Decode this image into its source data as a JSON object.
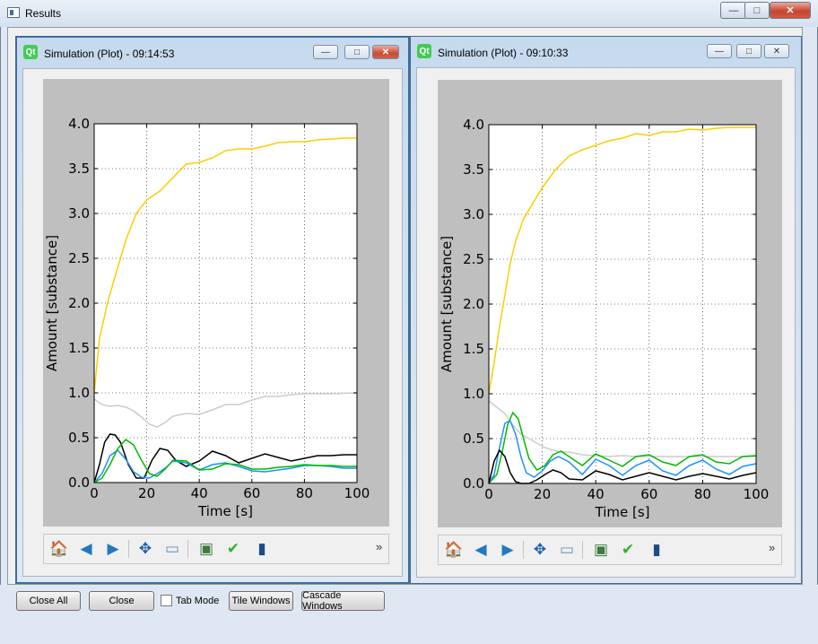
{
  "main_window": {
    "title": "Results",
    "min_glyph": "—",
    "max_glyph": "□",
    "close_glyph": "✕"
  },
  "windows": [
    {
      "title": "Simulation (Plot) - 09:14:53",
      "min_glyph": "—",
      "max_glyph": "□",
      "close_glyph": "✕"
    },
    {
      "title": "Simulation (Plot) - 09:10:33",
      "min_glyph": "—",
      "max_glyph": "□",
      "close_glyph": "✕"
    }
  ],
  "toolbar": {
    "icons": [
      "home-icon",
      "back-arrow-icon",
      "forward-arrow-icon",
      "pan-icon",
      "zoom-icon",
      "configure-subplots-icon",
      "check-icon",
      "save-icon"
    ],
    "more_label": "»"
  },
  "bottom": {
    "close_all": "Close All",
    "close": "Close",
    "tab_mode": "Tab Mode",
    "tab_mode_checked": false,
    "tile": "Tile Windows",
    "cascade": "Cascade Windows"
  },
  "chart_data": [
    {
      "type": "line",
      "xlabel": "Time [s]",
      "ylabel": "Amount [substance]",
      "xlim": [
        0,
        100
      ],
      "ylim": [
        0,
        4.0
      ],
      "xticks": [
        "0",
        "20",
        "40",
        "60",
        "80",
        "100"
      ],
      "yticks": [
        "0.0",
        "0.5",
        "1.0",
        "1.5",
        "2.0",
        "2.5",
        "3.0",
        "3.5",
        "4.0"
      ],
      "grid": true,
      "series": [
        {
          "color": "#ffcc00",
          "x": [
            0,
            2,
            5,
            8,
            12,
            16,
            20,
            25,
            30,
            35,
            40,
            45,
            50,
            55,
            60,
            65,
            70,
            75,
            80,
            85,
            90,
            95,
            100
          ],
          "y": [
            1.0,
            1.6,
            2.0,
            2.3,
            2.7,
            3.0,
            3.15,
            3.25,
            3.4,
            3.55,
            3.57,
            3.62,
            3.7,
            3.72,
            3.72,
            3.75,
            3.79,
            3.8,
            3.8,
            3.82,
            3.83,
            3.84,
            3.84
          ]
        },
        {
          "color": "#cccccc",
          "x": [
            0,
            3,
            6,
            9,
            12,
            15,
            18,
            21,
            24,
            27,
            30,
            35,
            40,
            45,
            50,
            55,
            60,
            65,
            70,
            75,
            80,
            90,
            100
          ],
          "y": [
            0.93,
            0.87,
            0.85,
            0.86,
            0.84,
            0.8,
            0.73,
            0.65,
            0.62,
            0.67,
            0.74,
            0.77,
            0.76,
            0.81,
            0.87,
            0.87,
            0.92,
            0.96,
            0.96,
            0.98,
            0.99,
            0.99,
            1.0
          ]
        },
        {
          "color": "#000000",
          "x": [
            0,
            2,
            4,
            6,
            8,
            10,
            13,
            16,
            19,
            22,
            25,
            28,
            31,
            35,
            40,
            45,
            50,
            55,
            60,
            65,
            70,
            75,
            80,
            85,
            90,
            95,
            100
          ],
          "y": [
            0,
            0.2,
            0.45,
            0.54,
            0.53,
            0.45,
            0.2,
            0.05,
            0.05,
            0.25,
            0.38,
            0.36,
            0.25,
            0.18,
            0.24,
            0.35,
            0.3,
            0.22,
            0.27,
            0.32,
            0.28,
            0.24,
            0.27,
            0.3,
            0.3,
            0.31,
            0.31
          ]
        },
        {
          "color": "#1e90ff",
          "x": [
            0,
            3,
            6,
            9,
            12,
            15,
            18,
            21,
            24,
            27,
            30,
            35,
            40,
            45,
            50,
            55,
            60,
            65,
            70,
            75,
            80,
            85,
            90,
            95,
            100
          ],
          "y": [
            0,
            0.1,
            0.3,
            0.36,
            0.26,
            0.12,
            0.06,
            0.05,
            0.1,
            0.16,
            0.24,
            0.22,
            0.14,
            0.2,
            0.22,
            0.18,
            0.13,
            0.12,
            0.14,
            0.16,
            0.19,
            0.19,
            0.18,
            0.16,
            0.16
          ]
        },
        {
          "color": "#00bb00",
          "x": [
            0,
            3,
            6,
            9,
            12,
            15,
            18,
            21,
            24,
            27,
            30,
            35,
            40,
            45,
            50,
            55,
            60,
            65,
            70,
            75,
            80,
            85,
            90,
            95,
            100
          ],
          "y": [
            0,
            0.05,
            0.2,
            0.38,
            0.48,
            0.42,
            0.25,
            0.1,
            0.07,
            0.15,
            0.25,
            0.24,
            0.14,
            0.15,
            0.21,
            0.2,
            0.15,
            0.15,
            0.17,
            0.18,
            0.2,
            0.19,
            0.19,
            0.18,
            0.18
          ]
        }
      ]
    },
    {
      "type": "line",
      "xlabel": "Time [s]",
      "ylabel": "Amount [substance]",
      "xlim": [
        0,
        100
      ],
      "ylim": [
        0,
        4.0
      ],
      "xticks": [
        "0",
        "20",
        "40",
        "60",
        "80",
        "100"
      ],
      "yticks": [
        "0.0",
        "0.5",
        "1.0",
        "1.5",
        "2.0",
        "2.5",
        "3.0",
        "3.5",
        "4.0"
      ],
      "grid": true,
      "series": [
        {
          "color": "#ffcc00",
          "x": [
            0,
            2,
            4,
            6,
            8,
            10,
            13,
            16,
            20,
            25,
            30,
            35,
            40,
            45,
            50,
            55,
            60,
            65,
            70,
            75,
            80,
            85,
            90,
            95,
            100
          ],
          "y": [
            1.0,
            1.35,
            1.75,
            2.1,
            2.45,
            2.7,
            2.95,
            3.1,
            3.3,
            3.5,
            3.65,
            3.72,
            3.77,
            3.82,
            3.85,
            3.9,
            3.88,
            3.92,
            3.92,
            3.95,
            3.94,
            3.96,
            3.97,
            3.97,
            3.97
          ]
        },
        {
          "color": "#cccccc",
          "x": [
            0,
            3,
            6,
            9,
            12,
            15,
            18,
            21,
            24,
            27,
            30,
            35,
            40,
            45,
            50,
            55,
            60,
            70,
            80,
            90,
            100
          ],
          "y": [
            0.92,
            0.85,
            0.78,
            0.65,
            0.55,
            0.5,
            0.45,
            0.4,
            0.37,
            0.35,
            0.35,
            0.32,
            0.31,
            0.3,
            0.31,
            0.3,
            0.3,
            0.3,
            0.3,
            0.3,
            0.3
          ]
        },
        {
          "color": "#00bb00",
          "x": [
            0,
            3,
            5,
            7,
            9,
            11,
            13,
            15,
            18,
            21,
            24,
            27,
            30,
            35,
            40,
            45,
            50,
            55,
            60,
            65,
            70,
            75,
            80,
            85,
            90,
            95,
            100
          ],
          "y": [
            0,
            0.1,
            0.35,
            0.65,
            0.79,
            0.72,
            0.5,
            0.28,
            0.15,
            0.2,
            0.32,
            0.36,
            0.3,
            0.2,
            0.33,
            0.26,
            0.19,
            0.3,
            0.32,
            0.24,
            0.2,
            0.3,
            0.32,
            0.24,
            0.22,
            0.3,
            0.31
          ]
        },
        {
          "color": "#1e90ff",
          "x": [
            0,
            2,
            4,
            6,
            8,
            10,
            12,
            14,
            17,
            20,
            23,
            26,
            30,
            35,
            40,
            45,
            50,
            55,
            60,
            65,
            70,
            75,
            80,
            85,
            90,
            95,
            100
          ],
          "y": [
            0,
            0.1,
            0.4,
            0.67,
            0.7,
            0.55,
            0.3,
            0.12,
            0.07,
            0.14,
            0.25,
            0.3,
            0.24,
            0.1,
            0.27,
            0.2,
            0.09,
            0.2,
            0.26,
            0.14,
            0.09,
            0.2,
            0.26,
            0.16,
            0.1,
            0.19,
            0.22
          ]
        },
        {
          "color": "#000000",
          "x": [
            0,
            2,
            4,
            6,
            8,
            10,
            12,
            15,
            18,
            21,
            24,
            27,
            30,
            35,
            40,
            45,
            50,
            55,
            60,
            65,
            70,
            75,
            80,
            85,
            90,
            95,
            100
          ],
          "y": [
            0,
            0.25,
            0.37,
            0.3,
            0.12,
            0.02,
            0,
            0.0,
            0.04,
            0.1,
            0.15,
            0.12,
            0.05,
            0.04,
            0.14,
            0.1,
            0.04,
            0.08,
            0.12,
            0.08,
            0.04,
            0.08,
            0.11,
            0.08,
            0.05,
            0.09,
            0.12
          ]
        }
      ]
    }
  ]
}
